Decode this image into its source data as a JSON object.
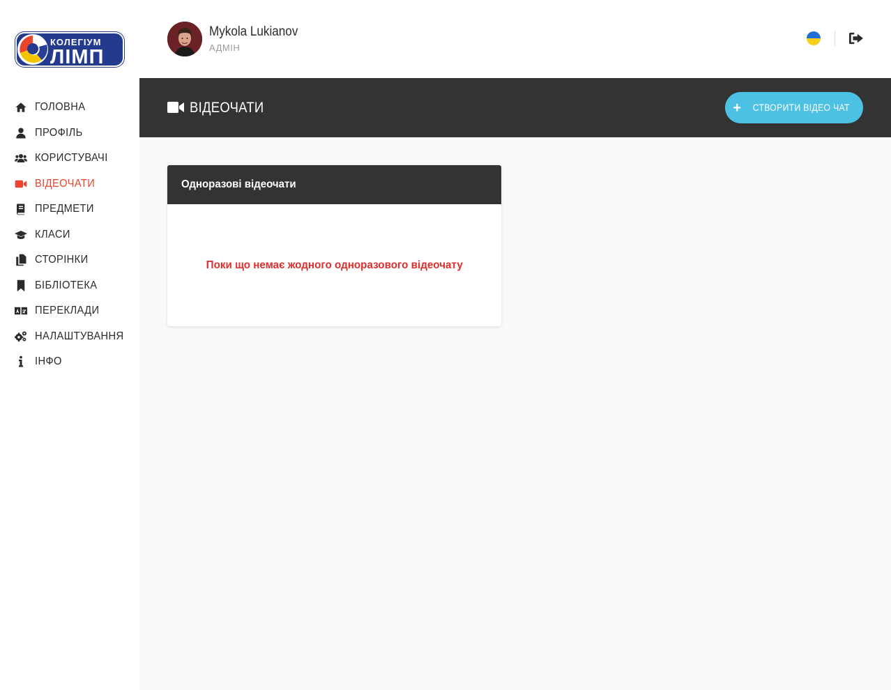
{
  "brand": {
    "logo_top": "КОЛЕГІУМ",
    "logo_main": "ЛІМП"
  },
  "user": {
    "name": "Mykola Lukianov",
    "role": "АДМІН"
  },
  "sidebar": {
    "items": [
      {
        "label": "ГОЛОВНА",
        "icon": "home-icon",
        "active": false
      },
      {
        "label": "ПРОФІЛЬ",
        "icon": "user-icon",
        "active": false
      },
      {
        "label": "КОРИСТУВАЧІ",
        "icon": "users-icon",
        "active": false
      },
      {
        "label": "ВІДЕОЧАТИ",
        "icon": "video-icon",
        "active": true
      },
      {
        "label": "ПРЕДМЕТИ",
        "icon": "book-icon",
        "active": false
      },
      {
        "label": "КЛАСИ",
        "icon": "graduation-cap-icon",
        "active": false
      },
      {
        "label": "СТОРІНКИ",
        "icon": "copy-icon",
        "active": false
      },
      {
        "label": "БІБЛІОТЕКА",
        "icon": "bookmark-icon",
        "active": false
      },
      {
        "label": "ПЕРЕКЛАДИ",
        "icon": "language-icon",
        "active": false
      },
      {
        "label": "НАЛАШТУВАННЯ",
        "icon": "cogs-icon",
        "active": false
      },
      {
        "label": "ІНФО",
        "icon": "info-icon",
        "active": false
      }
    ]
  },
  "page": {
    "title": "ВІДЕОЧАТИ",
    "create_button_label": "СТВОРИТИ ВІДЕО ЧАТ"
  },
  "card": {
    "title": "Одноразові відеочати",
    "empty_message": "Поки що немає жодного одноразового відеочату"
  },
  "colors": {
    "accent_active": "#e8452c",
    "header_dark": "#333333",
    "button_blue": "#4dc1e3",
    "empty_text": "#e02e2e",
    "flag_blue": "#1f6fd6",
    "flag_yellow": "#f6cf1a"
  }
}
